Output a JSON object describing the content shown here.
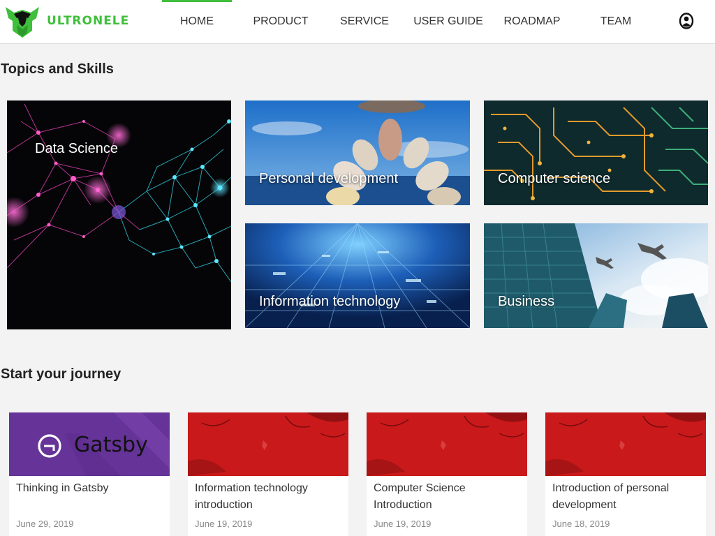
{
  "brand": {
    "name": "ULTRONELE",
    "accent": "#3fbf3b"
  },
  "nav": {
    "items": [
      {
        "label": "HOME",
        "active": true
      },
      {
        "label": "PRODUCT"
      },
      {
        "label": "SERVICE"
      },
      {
        "label": "USER GUIDE"
      },
      {
        "label": "ROADMAP"
      },
      {
        "label": "TEAM"
      }
    ],
    "user_icon": "user-circle-icon"
  },
  "topics": {
    "title": "Topics and Skills",
    "tiles": [
      {
        "label": "Data Science"
      },
      {
        "label": "Personal development"
      },
      {
        "label": "Computer science"
      },
      {
        "label": "Information technology"
      },
      {
        "label": "Business"
      }
    ]
  },
  "journey": {
    "title": "Start your journey",
    "cards": [
      {
        "title": "Thinking in Gatsby",
        "date": "June 29, 2019",
        "image_text": "Gatsby"
      },
      {
        "title": "Information technology introduction",
        "date": "June 19, 2019"
      },
      {
        "title": "Computer Science Introduction",
        "date": "June 19, 2019"
      },
      {
        "title": "Introduction of personal development",
        "date": "June 18, 2019"
      }
    ]
  }
}
